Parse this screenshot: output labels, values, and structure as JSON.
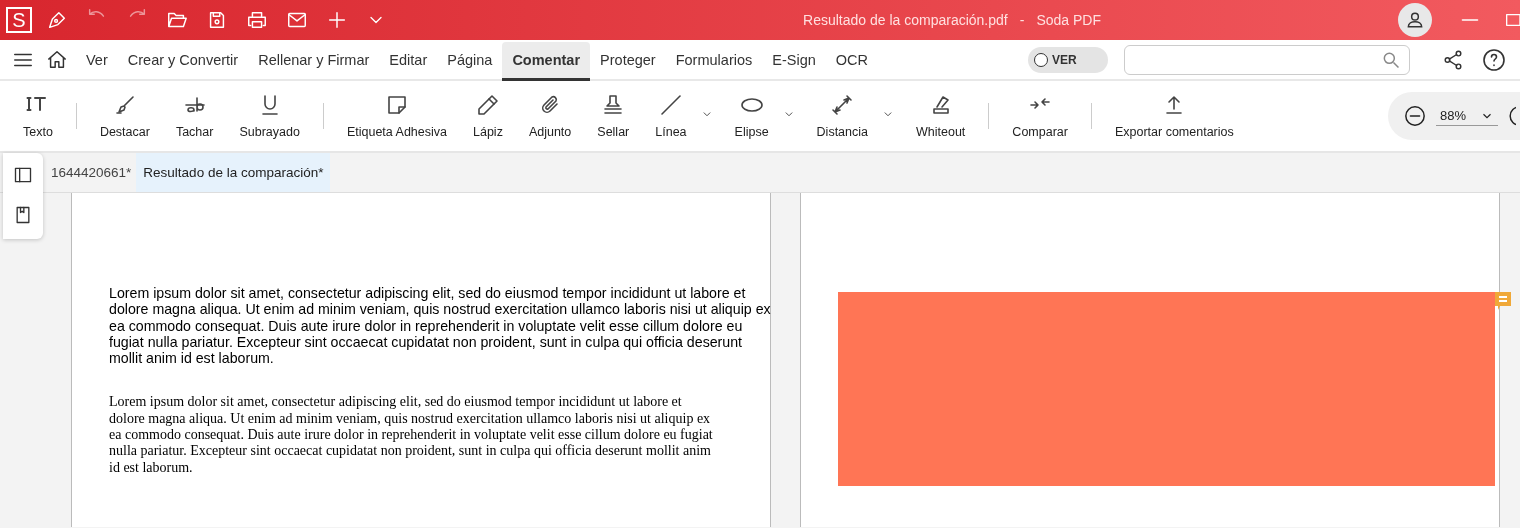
{
  "window": {
    "logo": "S",
    "title": "Resultado de la comparación.pdf",
    "separator": "-",
    "app_name": "Soda PDF"
  },
  "menu": [
    {
      "label": "Ver",
      "selected": false
    },
    {
      "label": "Crear y Convertir",
      "selected": false
    },
    {
      "label": "Rellenar y Firmar",
      "selected": false
    },
    {
      "label": "Editar",
      "selected": false
    },
    {
      "label": "Página",
      "selected": false
    },
    {
      "label": "Comentar",
      "selected": true
    },
    {
      "label": "Proteger",
      "selected": false
    },
    {
      "label": "Formularios",
      "selected": false
    },
    {
      "label": "E-Sign",
      "selected": false
    },
    {
      "label": "OCR",
      "selected": false
    }
  ],
  "view_toggle": {
    "label": "VER",
    "on": false
  },
  "toolbar": [
    {
      "kind": "tool",
      "label": "Texto"
    },
    {
      "kind": "separator"
    },
    {
      "kind": "tool",
      "label": "Destacar"
    },
    {
      "kind": "tool",
      "label": "Tachar"
    },
    {
      "kind": "tool",
      "label": "Subrayado"
    },
    {
      "kind": "separator"
    },
    {
      "kind": "tool",
      "label": "Etiqueta Adhesiva"
    },
    {
      "kind": "tool",
      "label": "Lápiz"
    },
    {
      "kind": "tool",
      "label": "Adjunto"
    },
    {
      "kind": "tool",
      "label": "Sellar"
    },
    {
      "kind": "dropdown",
      "label": "Línea"
    },
    {
      "kind": "dropdown",
      "label": "Elipse"
    },
    {
      "kind": "dropdown",
      "label": "Distancia"
    },
    {
      "kind": "tool",
      "label": "Whiteout"
    },
    {
      "kind": "separator"
    },
    {
      "kind": "tool",
      "label": "Comparar"
    },
    {
      "kind": "separator"
    },
    {
      "kind": "tool",
      "label": "Exportar comentarios"
    }
  ],
  "zoom": {
    "value": "88%"
  },
  "doc_tabs": [
    {
      "label": "1644420661*",
      "selected": false
    },
    {
      "label": "Resultado de la comparación*",
      "selected": true
    }
  ],
  "left_page": {
    "paragraphs": [
      {
        "kind": "sans",
        "text": "Lorem ipsum dolor sit amet, consectetur adipiscing elit, sed do eiusmod tempor incididunt ut labore et dolore magna aliqua. Ut enim ad minim veniam, quis nostrud exercitation ullamco laboris nisi ut aliquip ex ea commodo consequat. Duis aute irure dolor in reprehenderit in voluptate velit esse cillum dolore eu fugiat nulla pariatur. Excepteur sint occaecat cupidatat non proident, sunt in culpa qui officia deserunt mollit anim id est laborum."
      },
      {
        "kind": "serif",
        "text": "Lorem ipsum dolor sit amet, consectetur adipiscing elit, sed do eiusmod tempor incididunt ut labore et dolore magna aliqua. Ut enim ad minim veniam, quis nostrud exercitation ullamco laboris nisi ut aliquip ex ea commodo consequat. Duis aute irure dolor in reprehenderit in voluptate velit esse cillum dolore eu fugiat nulla pariatur. Excepteur sint occaecat cupidatat non proident, sunt in culpa qui officia deserunt mollit anim id est laborum."
      }
    ]
  },
  "right_page": {
    "highlight": {
      "color": "#ff7555"
    },
    "comment": {
      "color": "#f0a838"
    }
  }
}
